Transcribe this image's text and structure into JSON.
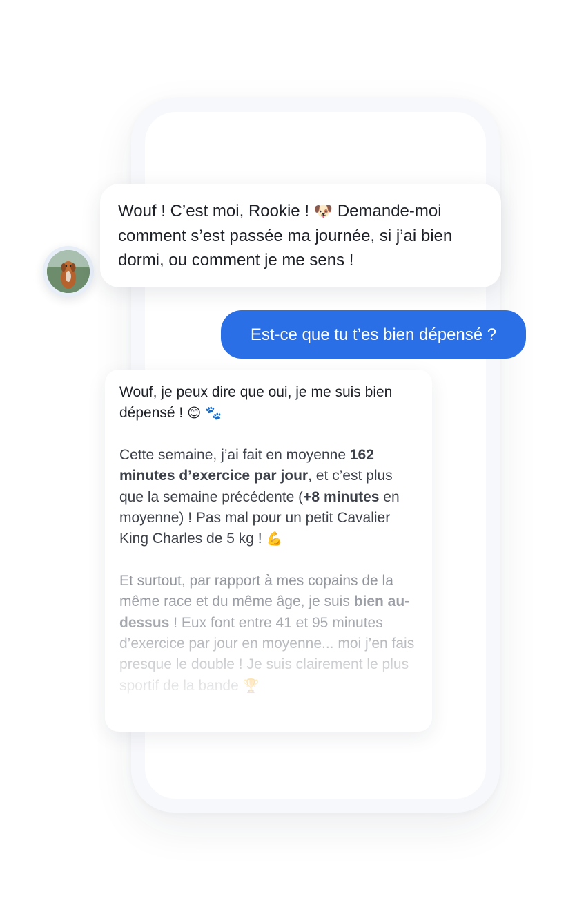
{
  "intro": {
    "part1": "Wouf ! C’est moi, Rookie ! ",
    "emoji": "🐶",
    "part2": " Demande-moi comment s’est passée ma journée, si j’ai bien dormi, ou comment je me sens !"
  },
  "user_message": "Est-ce que tu t’es bien dépensé ?",
  "answer": {
    "p1": {
      "text": "Wouf, je peux dire que oui, je me suis bien dépensé ! ",
      "emoji1": "😊",
      "emoji2": "🐾"
    },
    "p2": {
      "t1": "Cette semaine, j’ai fait en moyenne ",
      "b1": "162 minutes d’exercice par jour",
      "t2": ", et c’est plus que la semaine précédente (",
      "b2": "+8 minutes",
      "t3": " en moyenne) ! Pas mal pour un petit Cavalier King Charles de 5 kg ! ",
      "emoji": "💪"
    },
    "p3": {
      "t1": "Et surtout, par rapport à mes copains de la même race et du même âge, je suis ",
      "b1": "bien au-dessus",
      "t2": " ! Eux font entre 41 et 95 minutes d’exercice par jour en moyenne... moi j’en fais presque le double ! Je suis clairement le plus sportif de la bande ",
      "emoji": "🏆"
    }
  },
  "colors": {
    "user_bubble": "#2a6fe6",
    "avatar_ring": "#e8eef8"
  },
  "icons": {
    "avatar": "dog-photo-avatar"
  }
}
